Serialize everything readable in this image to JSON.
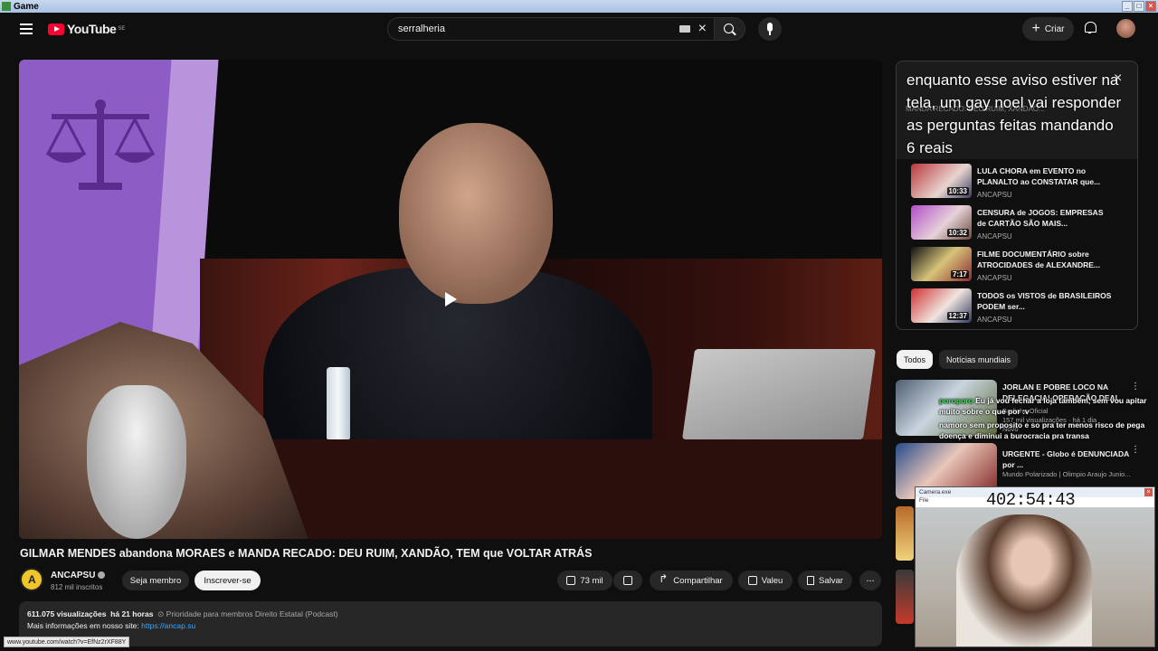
{
  "window": {
    "title": "Game"
  },
  "header": {
    "brand": "YouTube",
    "brand_country": "SE",
    "search_value": "serralheria",
    "create_label": "Criar"
  },
  "video": {
    "title": "GILMAR MENDES abandona MORAES e MANDA RECADO: DEU RUIM, XANDÃO, TEM que VOLTAR ATRÁS",
    "channel": "ANCAPSU",
    "subscribers": "812 mil inscritos",
    "join_label": "Seja membro",
    "subscribe_label": "Inscrever-se",
    "likes": "73 mil",
    "share_label": "Compartilhar",
    "thanks_label": "Valeu",
    "save_label": "Salvar",
    "more_label": "...",
    "views": "611.075 visualizações",
    "age": "há 21 horas",
    "tags": "Prioridade para membros  Direito Estatal (Podcast)",
    "info_prefix": "Mais informações em nosso site:",
    "info_link": "https://ancap.su"
  },
  "status_url": "www.youtube.com/watch?v=EfNz2rXF88Y",
  "playlist": {
    "overlay_text": "enquanto esse aviso estiver na tela, um gay noel vai responder as perguntas feitas mandando 6 reais",
    "ghost_text": "MANDA RECADO: DEU RUIM, XANDÃO...",
    "items": [
      {
        "title": "LULA CHORA em EVENTO no PLANALTO ao CONSTATAR que...",
        "channel": "ANCAPSU",
        "duration": "10:33"
      },
      {
        "title": "CENSURA de JOGOS: EMPRESAS de CARTÃO SÃO MAIS...",
        "channel": "ANCAPSU",
        "duration": "10:32"
      },
      {
        "title": "FILME DOCUMENTÁRIO sobre ATROCIDADES de ALEXANDRE...",
        "channel": "ANCAPSU",
        "duration": "7:17"
      },
      {
        "title": "TODOS os VISTOS de BRASILEIROS PODEM ser...",
        "channel": "ANCAPSU",
        "duration": "12:37"
      }
    ]
  },
  "chips": {
    "all": "Todos",
    "world_news": "Notícias mundiais"
  },
  "recommendations": [
    {
      "title": "JORLAN E POBRE LOCO NA DELEGACIA! OPERAÇÃO DEAL",
      "channel": "Badinho Oficial",
      "meta": "157 mil visualizações · há 1 dia",
      "badge": "Novo"
    },
    {
      "title": "URGENTE - Globo é DENUNCIADA por ...",
      "channel": "Mundo Polarizado | Olimpio Araujo Junio...",
      "meta": "",
      "badge": ""
    }
  ],
  "chat_overlay": {
    "user": "poroporo",
    "lines": [
      "Eu já vou fechar a loja também, sem vou apitar muito sobre o que por :v",
      "namoro sem proposito e so pra ter menos risco de pega doença e diminui a burocracia pra transa"
    ]
  },
  "webcam": {
    "window_title": "Camera.exe",
    "menu": "File",
    "timer": "402:54:43"
  }
}
